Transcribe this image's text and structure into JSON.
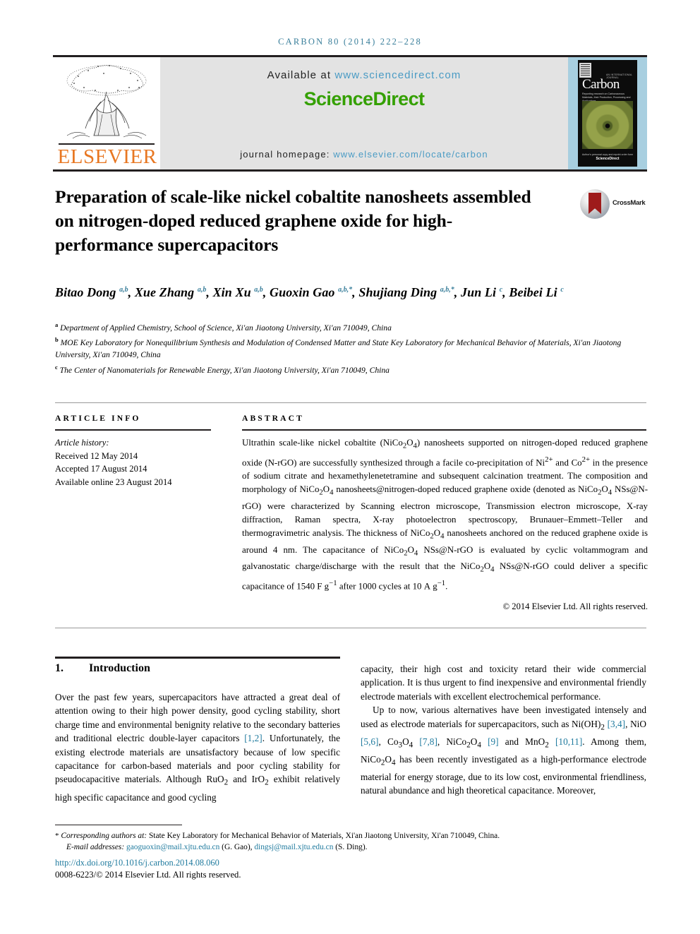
{
  "running_head": "CARBON 80 (2014) 222–228",
  "masthead": {
    "publisher_logo_name": "ELSEVIER",
    "available_prefix": "Available at ",
    "available_url": "www.sciencedirect.com",
    "sciencedirect_logo": "ScienceDirect",
    "homepage_prefix": "journal homepage: ",
    "homepage_url": "www.elsevier.com/locate/carbon",
    "cover": {
      "title": "Carbon",
      "kicker": "AN INTERNATIONAL JOURNAL",
      "subtitle": "Reporting research on Carbonaceous Materials, their Production, Processing and Applications",
      "footer_line1": "Author's personal copy and reprint order form",
      "footer_brand": "ScienceDirect"
    }
  },
  "article": {
    "title": "Preparation of scale-like nickel cobaltite nanosheets assembled on nitrogen-doped reduced graphene oxide for high-performance supercapacitors",
    "crossmark_label": "CrossMark",
    "authors": [
      {
        "name": "Bitao Dong",
        "affil": "a,b",
        "sep": ", "
      },
      {
        "name": "Xue Zhang",
        "affil": "a,b",
        "sep": ", "
      },
      {
        "name": "Xin Xu",
        "affil": "a,b",
        "sep": ", "
      },
      {
        "name": "Guoxin Gao",
        "affil": "a,b,*",
        "sep": ", "
      },
      {
        "name": "Shujiang Ding",
        "affil": "a,b,*",
        "sep": ", "
      },
      {
        "name": "Jun Li",
        "affil": "c",
        "sep": ", "
      },
      {
        "name": "Beibei Li",
        "affil": "c",
        "sep": ""
      }
    ],
    "affiliations": [
      {
        "marker": "a",
        "text": "Department of Applied Chemistry, School of Science, Xi'an Jiaotong University, Xi'an 710049, China"
      },
      {
        "marker": "b",
        "text": "MOE Key Laboratory for Nonequilibrium Synthesis and Modulation of Condensed Matter and State Key Laboratory for Mechanical Behavior of Materials, Xi'an Jiaotong University, Xi'an 710049, China"
      },
      {
        "marker": "c",
        "text": "The Center of Nanomaterials for Renewable Energy, Xi'an Jiaotong University, Xi'an 710049, China"
      }
    ]
  },
  "article_info": {
    "heading": "ARTICLE INFO",
    "history_label": "Article history:",
    "received": "Received 12 May 2014",
    "accepted": "Accepted 17 August 2014",
    "available_online": "Available online 23 August 2014"
  },
  "abstract": {
    "heading": "ABSTRACT",
    "copyright": "© 2014 Elsevier Ltd. All rights reserved."
  },
  "introduction": {
    "number": "1.",
    "heading": "Introduction"
  },
  "footnote": {
    "star": "*",
    "corresponding_italic": "Corresponding authors at:",
    "corresponding_text": " State Key Laboratory for Mechanical Behavior of Materials, Xi'an Jiaotong University, Xi'an 710049, China.",
    "email_label": "E-mail addresses:",
    "email1": "gaoguoxin@mail.xjtu.edu.cn",
    "email1_owner": " (G. Gao), ",
    "email2": "dingsj@mail.xjtu.edu.cn",
    "email2_owner": " (S. Ding).",
    "doi": "http://dx.doi.org/10.1016/j.carbon.2014.08.060",
    "issn": "0008-6223/© 2014 Elsevier Ltd. All rights reserved."
  },
  "colors": {
    "link_blue": "#1f7a9e",
    "banner_blue": "#4a9bc4",
    "sciencedirect_green": "#34a000",
    "elsevier_orange": "#e87722",
    "crossmark_red": "#9e1b1b"
  }
}
